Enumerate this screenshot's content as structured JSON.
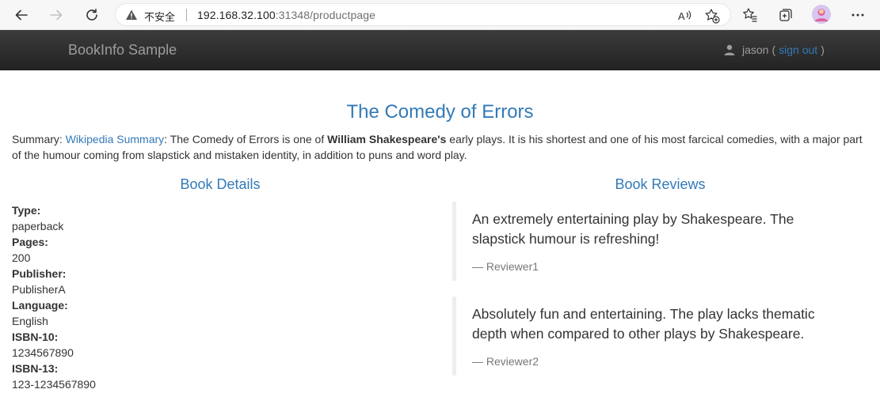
{
  "browser": {
    "security_label": "不安全",
    "url_host": "192.168.32.100",
    "url_rest": ":31348/productpage",
    "icons": {
      "back": "arrow-left-icon",
      "forward": "arrow-right-icon",
      "refresh": "refresh-icon",
      "warning": "warning-triangle-icon",
      "read_aloud": "read-aloud-icon",
      "add_favorite": "add-favorite-icon",
      "favorites": "favorites-icon",
      "collections": "collections-icon",
      "profile": "profile-avatar",
      "more": "more-icon"
    }
  },
  "navbar": {
    "brand": "BookInfo Sample",
    "user_name": "jason",
    "paren_open": "(",
    "sign_out": "sign out",
    "paren_close": ")"
  },
  "book": {
    "title": "The Comedy of Errors",
    "summary_prefix": "Summary: ",
    "summary_link": "Wikipedia Summary",
    "summary_text_1": ": The Comedy of Errors is one of ",
    "summary_bold": "William Shakespeare's",
    "summary_text_2": " early plays. It is his shortest and one of his most farcical comedies, with a major part of the humour coming from slapstick and mistaken identity, in addition to puns and word play."
  },
  "details": {
    "heading": "Book Details",
    "items": [
      {
        "label": "Type:",
        "value": "paperback"
      },
      {
        "label": "Pages:",
        "value": "200"
      },
      {
        "label": "Publisher:",
        "value": "PublisherA"
      },
      {
        "label": "Language:",
        "value": "English"
      },
      {
        "label": "ISBN-10:",
        "value": "1234567890"
      },
      {
        "label": "ISBN-13:",
        "value": "123-1234567890"
      }
    ]
  },
  "reviews": {
    "heading": "Book Reviews",
    "items": [
      {
        "text": "An extremely entertaining play by Shakespeare. The slapstick humour is refreshing!",
        "author": "— Reviewer1"
      },
      {
        "text": "Absolutely fun and entertaining. The play lacks thematic depth when compared to other plays by Shakespeare.",
        "author": "— Reviewer2"
      }
    ]
  },
  "colors": {
    "link": "#337ab7",
    "navbar_top": "#3c3c3c",
    "navbar_bottom": "#222222",
    "nav_text": "#9d9d9d"
  }
}
